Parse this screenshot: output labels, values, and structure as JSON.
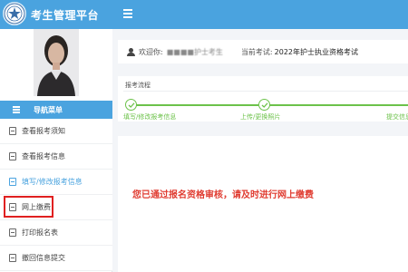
{
  "header": {
    "title": "考生管理平台",
    "menu_icon": "hamburger-icon",
    "logo_icon": "emblem-logo"
  },
  "sidebar": {
    "avatar_icon": "user-photo",
    "nav_title": "导航菜单",
    "items": [
      {
        "label": "查看报考须知",
        "icon": "document-icon",
        "active": false
      },
      {
        "label": "查看报考信息",
        "icon": "document-icon",
        "active": false
      },
      {
        "label": "填写/修改报考信息",
        "icon": "document-icon",
        "active": true
      },
      {
        "label": "网上缴费",
        "icon": "document-icon",
        "active": false
      },
      {
        "label": "打印报名表",
        "icon": "document-icon",
        "active": false
      },
      {
        "label": "撤回信息提交",
        "icon": "document-icon",
        "active": false
      }
    ]
  },
  "welcome": {
    "greeting": "欢迎你:",
    "user_name": "■■■■护士考生",
    "exam_label": "当前考试:",
    "exam_name": "2022年护士执业资格考试"
  },
  "flow": {
    "title": "报考流程",
    "steps": [
      {
        "label": "填写/修改报考信息",
        "status": "done"
      },
      {
        "label": "上传/更换照片",
        "status": "done"
      },
      {
        "label": "提交信息",
        "status": "done"
      }
    ]
  },
  "notice": {
    "message": "您已通过报名资格审核，请及时进行网上缴费"
  },
  "colors": {
    "primary": "#4aa3df",
    "success": "#6cc24a",
    "alert": "#e03c31",
    "highlight_border": "#e02020"
  }
}
